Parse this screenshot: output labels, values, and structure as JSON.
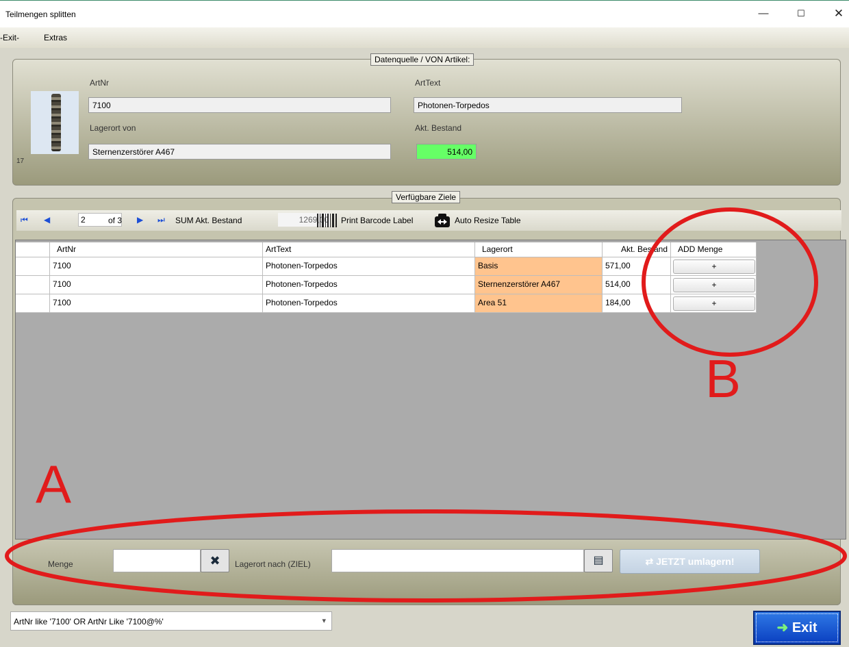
{
  "window": {
    "title": "Teilmengen splitten",
    "controls": {
      "minimize": "—",
      "maximize": "☐",
      "close": "✕"
    }
  },
  "menu": {
    "exit": "-Exit-",
    "extras": "Extras"
  },
  "source": {
    "group_title": "Datenquelle / VON Artikel:",
    "artnr_label": "ArtNr",
    "artnr": "7100",
    "arttext_label": "ArtText",
    "arttext": "Photonen-Torpedos",
    "lagerort_label": "Lagerort von",
    "lagerort": "Sternenzerstörer A467",
    "bestand_label": "Akt. Bestand",
    "bestand": "514,00",
    "image_caption": "17"
  },
  "targets": {
    "group_title": "Verfügbare Ziele",
    "navigator": {
      "first": "⏮",
      "prev": "◀",
      "position": "2",
      "of": "of 3",
      "next": "▶",
      "last": "⏭"
    },
    "sum_label": "SUM Akt. Bestand",
    "sum_value": "1269,00",
    "print_label": "Print Barcode Label",
    "resize_label": "Auto Resize Table",
    "columns": [
      "ArtNr",
      "ArtText",
      "Lagerort",
      "Akt. Bestand",
      "ADD Menge"
    ],
    "rows": [
      {
        "artnr": "7100",
        "arttext": "Photonen-Torpedos",
        "lagerort": "Basis",
        "bestand": "571,00",
        "add": "+"
      },
      {
        "artnr": "7100",
        "arttext": "Photonen-Torpedos",
        "lagerort": "Sternenzerstörer A467",
        "bestand": "514,00",
        "add": "+"
      },
      {
        "artnr": "7100",
        "arttext": "Photonen-Torpedos",
        "lagerort": "Area 51",
        "bestand": "184,00",
        "add": "+"
      }
    ]
  },
  "transfer": {
    "menge_label": "Menge",
    "menge_value": "",
    "clear_icon": "✖",
    "ziel_label": "Lagerort nach (ZIEL)",
    "ziel_value": "",
    "lookup_icon": "▤",
    "jetzt_label": "⇄ JETZT umlagern!"
  },
  "filter": {
    "value": "ArtNr like '7100' OR ArtNr Like '7100@%'"
  },
  "exit_button": {
    "icon": "➜",
    "label": "Exit"
  },
  "annotations": {
    "a": "A",
    "b": "B",
    "color": "#e11b1b"
  },
  "colors": {
    "highlight_green": "#66ff66",
    "lagerort_orange": "#ffc48e",
    "exit_blue": "#0a3fc0"
  }
}
